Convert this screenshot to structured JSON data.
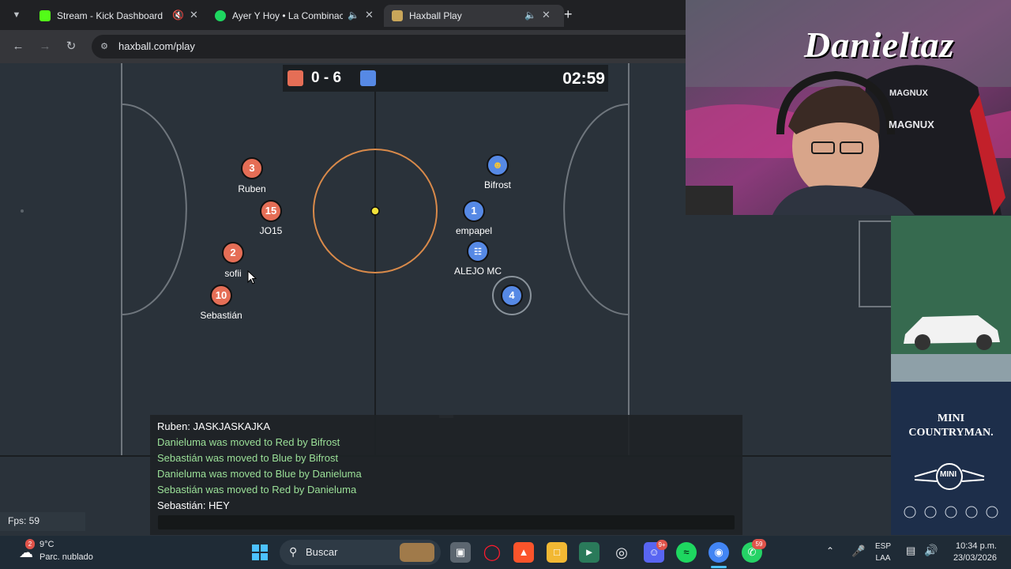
{
  "browser": {
    "tabs": [
      {
        "title": "Stream - Kick Dashboard",
        "active": false,
        "favicon_color": "#53fc18"
      },
      {
        "title": "Ayer Y Hoy • La Combinación",
        "active": false,
        "favicon_color": "#1ed760"
      },
      {
        "title": "Haxball Play",
        "active": true,
        "favicon_color": "#c9a65a"
      }
    ],
    "url": "haxball.com/play"
  },
  "game": {
    "score": "0 - 6",
    "timer": "02:59",
    "red_color": "#e56e56",
    "blue_color": "#5689e5",
    "players": [
      {
        "team": "red",
        "number": "3",
        "name": "Ruben"
      },
      {
        "team": "red",
        "number": "15",
        "name": "JO15"
      },
      {
        "team": "red",
        "number": "2",
        "name": "sofii"
      },
      {
        "team": "red",
        "number": "10",
        "name": "Sebastián"
      },
      {
        "team": "blue",
        "number": "",
        "name": "Bifrost",
        "icon": "emoji-face-icon"
      },
      {
        "team": "blue",
        "number": "1",
        "name": "empapel"
      },
      {
        "team": "blue",
        "number": "",
        "name": "ALEJO MC",
        "icon": "robot-icon"
      },
      {
        "team": "blue",
        "number": "4",
        "name": ""
      }
    ],
    "fps": "Fps: 59"
  },
  "chat": {
    "lines": [
      {
        "type": "player",
        "text": "Ruben: JASKJASKAJKA"
      },
      {
        "type": "system",
        "text": "Danieluma was moved to Red by Bifrost"
      },
      {
        "type": "system",
        "text": "Sebastián was moved to Blue by Bifrost"
      },
      {
        "type": "system",
        "text": "Danieluma was moved to Blue by Danieluma"
      },
      {
        "type": "system",
        "text": "Sebastián was moved to Red by Danieluma"
      },
      {
        "type": "player",
        "text": "Sebastián: HEY"
      }
    ]
  },
  "webcam": {
    "chair_brand": "MAGNUX",
    "graffiti": "Danieltaz"
  },
  "ad": {
    "title_line1": "MINI",
    "title_line2": "COUNTRYMAN.",
    "logo": "MINI"
  },
  "taskbar": {
    "weather_temp": "9°C",
    "weather_desc": "Parc. nublado",
    "weather_badge": "2",
    "search_placeholder": "Buscar",
    "whatsapp_badge": "59",
    "discord_badge": "9+",
    "lang_line1": "ESP",
    "lang_line2": "LAA",
    "time": "10:34 p.m.",
    "date": "23/03/2026"
  }
}
